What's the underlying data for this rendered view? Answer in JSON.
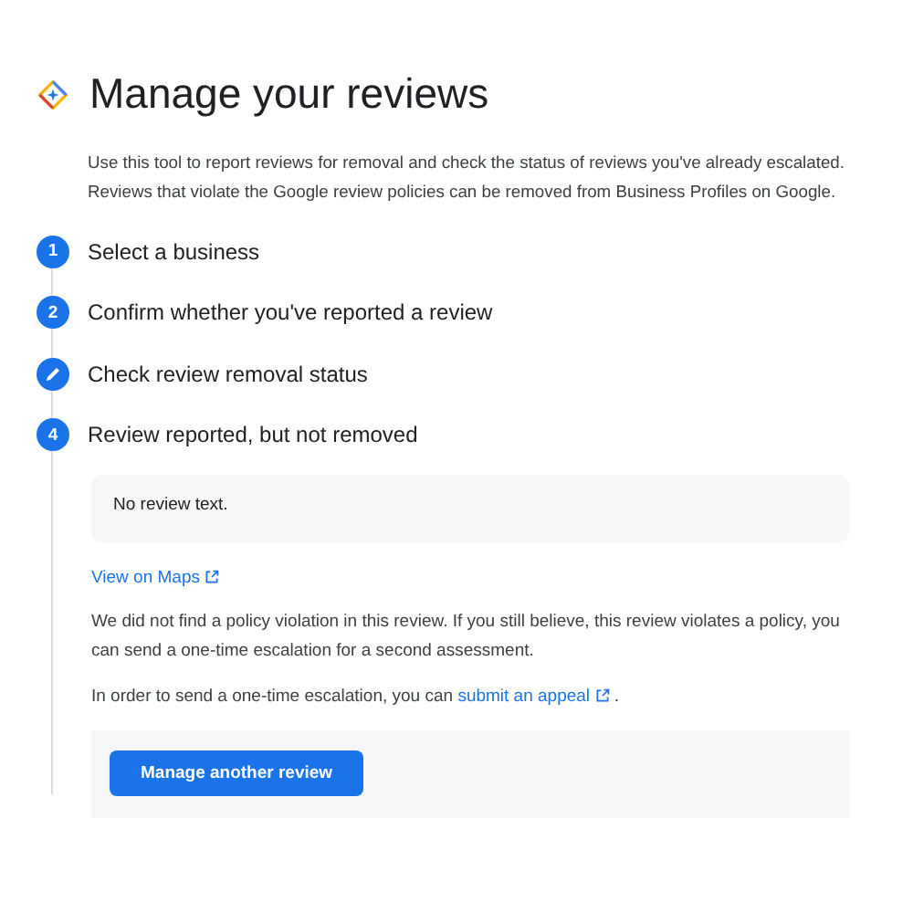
{
  "title": "Manage your reviews",
  "intro": "Use this tool to report reviews for removal and check the status of reviews you've already escalated. Reviews that violate the Google review policies can be removed from Business Profiles on Google.",
  "steps": [
    {
      "kind": "number",
      "badge": "1",
      "label": "Select a business"
    },
    {
      "kind": "number",
      "badge": "2",
      "label": "Confirm whether you've reported a review"
    },
    {
      "kind": "edit",
      "label": "Check review removal status"
    },
    {
      "kind": "number",
      "badge": "4",
      "label": "Review reported, but not removed"
    }
  ],
  "review_text": "No review text.",
  "maps_link": "View on Maps",
  "result": "We did not find a policy violation in this review. If you still believe, this review violates a policy, you can send a one-time escalation for a second assessment.",
  "appeal": {
    "before": "In order to send a one-time escalation, you can ",
    "link": "submit an appeal",
    "after": " ."
  },
  "button": "Manage another review"
}
